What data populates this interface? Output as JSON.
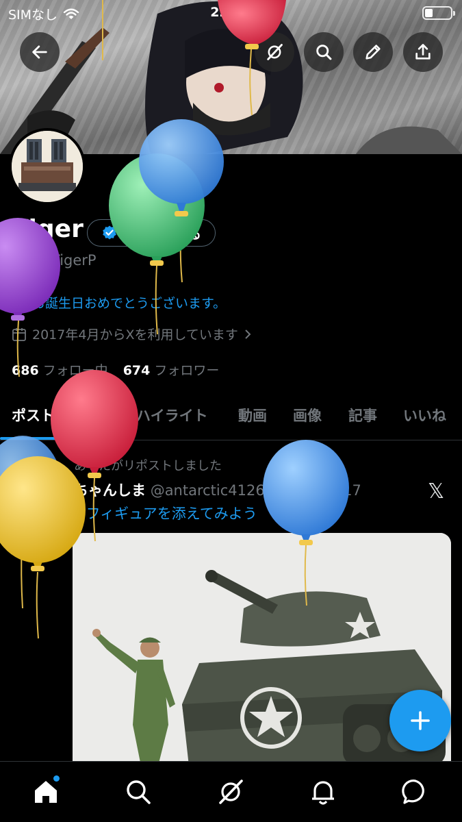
{
  "status_bar": {
    "carrier": "SIMなし",
    "time": "22:08"
  },
  "top_actions": [
    "back-icon",
    "grok-icon",
    "search-icon",
    "edit-icon",
    "share-icon"
  ],
  "profile": {
    "display_name": "Tiger",
    "verify_label": "認証を受ける",
    "handle": "@GWTigerP",
    "birthday_text": "お誕生日おめでとうございます。",
    "joined_text": "2017年4月からXを利用しています",
    "following_count": "686",
    "following_label": "フォロー中",
    "followers_count": "674",
    "followers_label": "フォロワー"
  },
  "tabs": [
    "ポスト",
    "返信",
    "ハイライト",
    "動画",
    "画像",
    "記事",
    "いいね"
  ],
  "active_tab": "ポスト",
  "post": {
    "repost_line": "あなたがリポストしました",
    "author_name": "ちゃんしま",
    "author_meta": "@antarctic4126 · 2026/04/17",
    "text": "#フィギュアを添えてみよう",
    "source_logo": "𝕏"
  },
  "bottom_nav": [
    "home-icon",
    "search-icon",
    "grok-icon",
    "notifications-icon",
    "messages-icon"
  ],
  "colors": {
    "accent": "#1d9bf0",
    "muted": "#71767b",
    "background": "#000000"
  }
}
